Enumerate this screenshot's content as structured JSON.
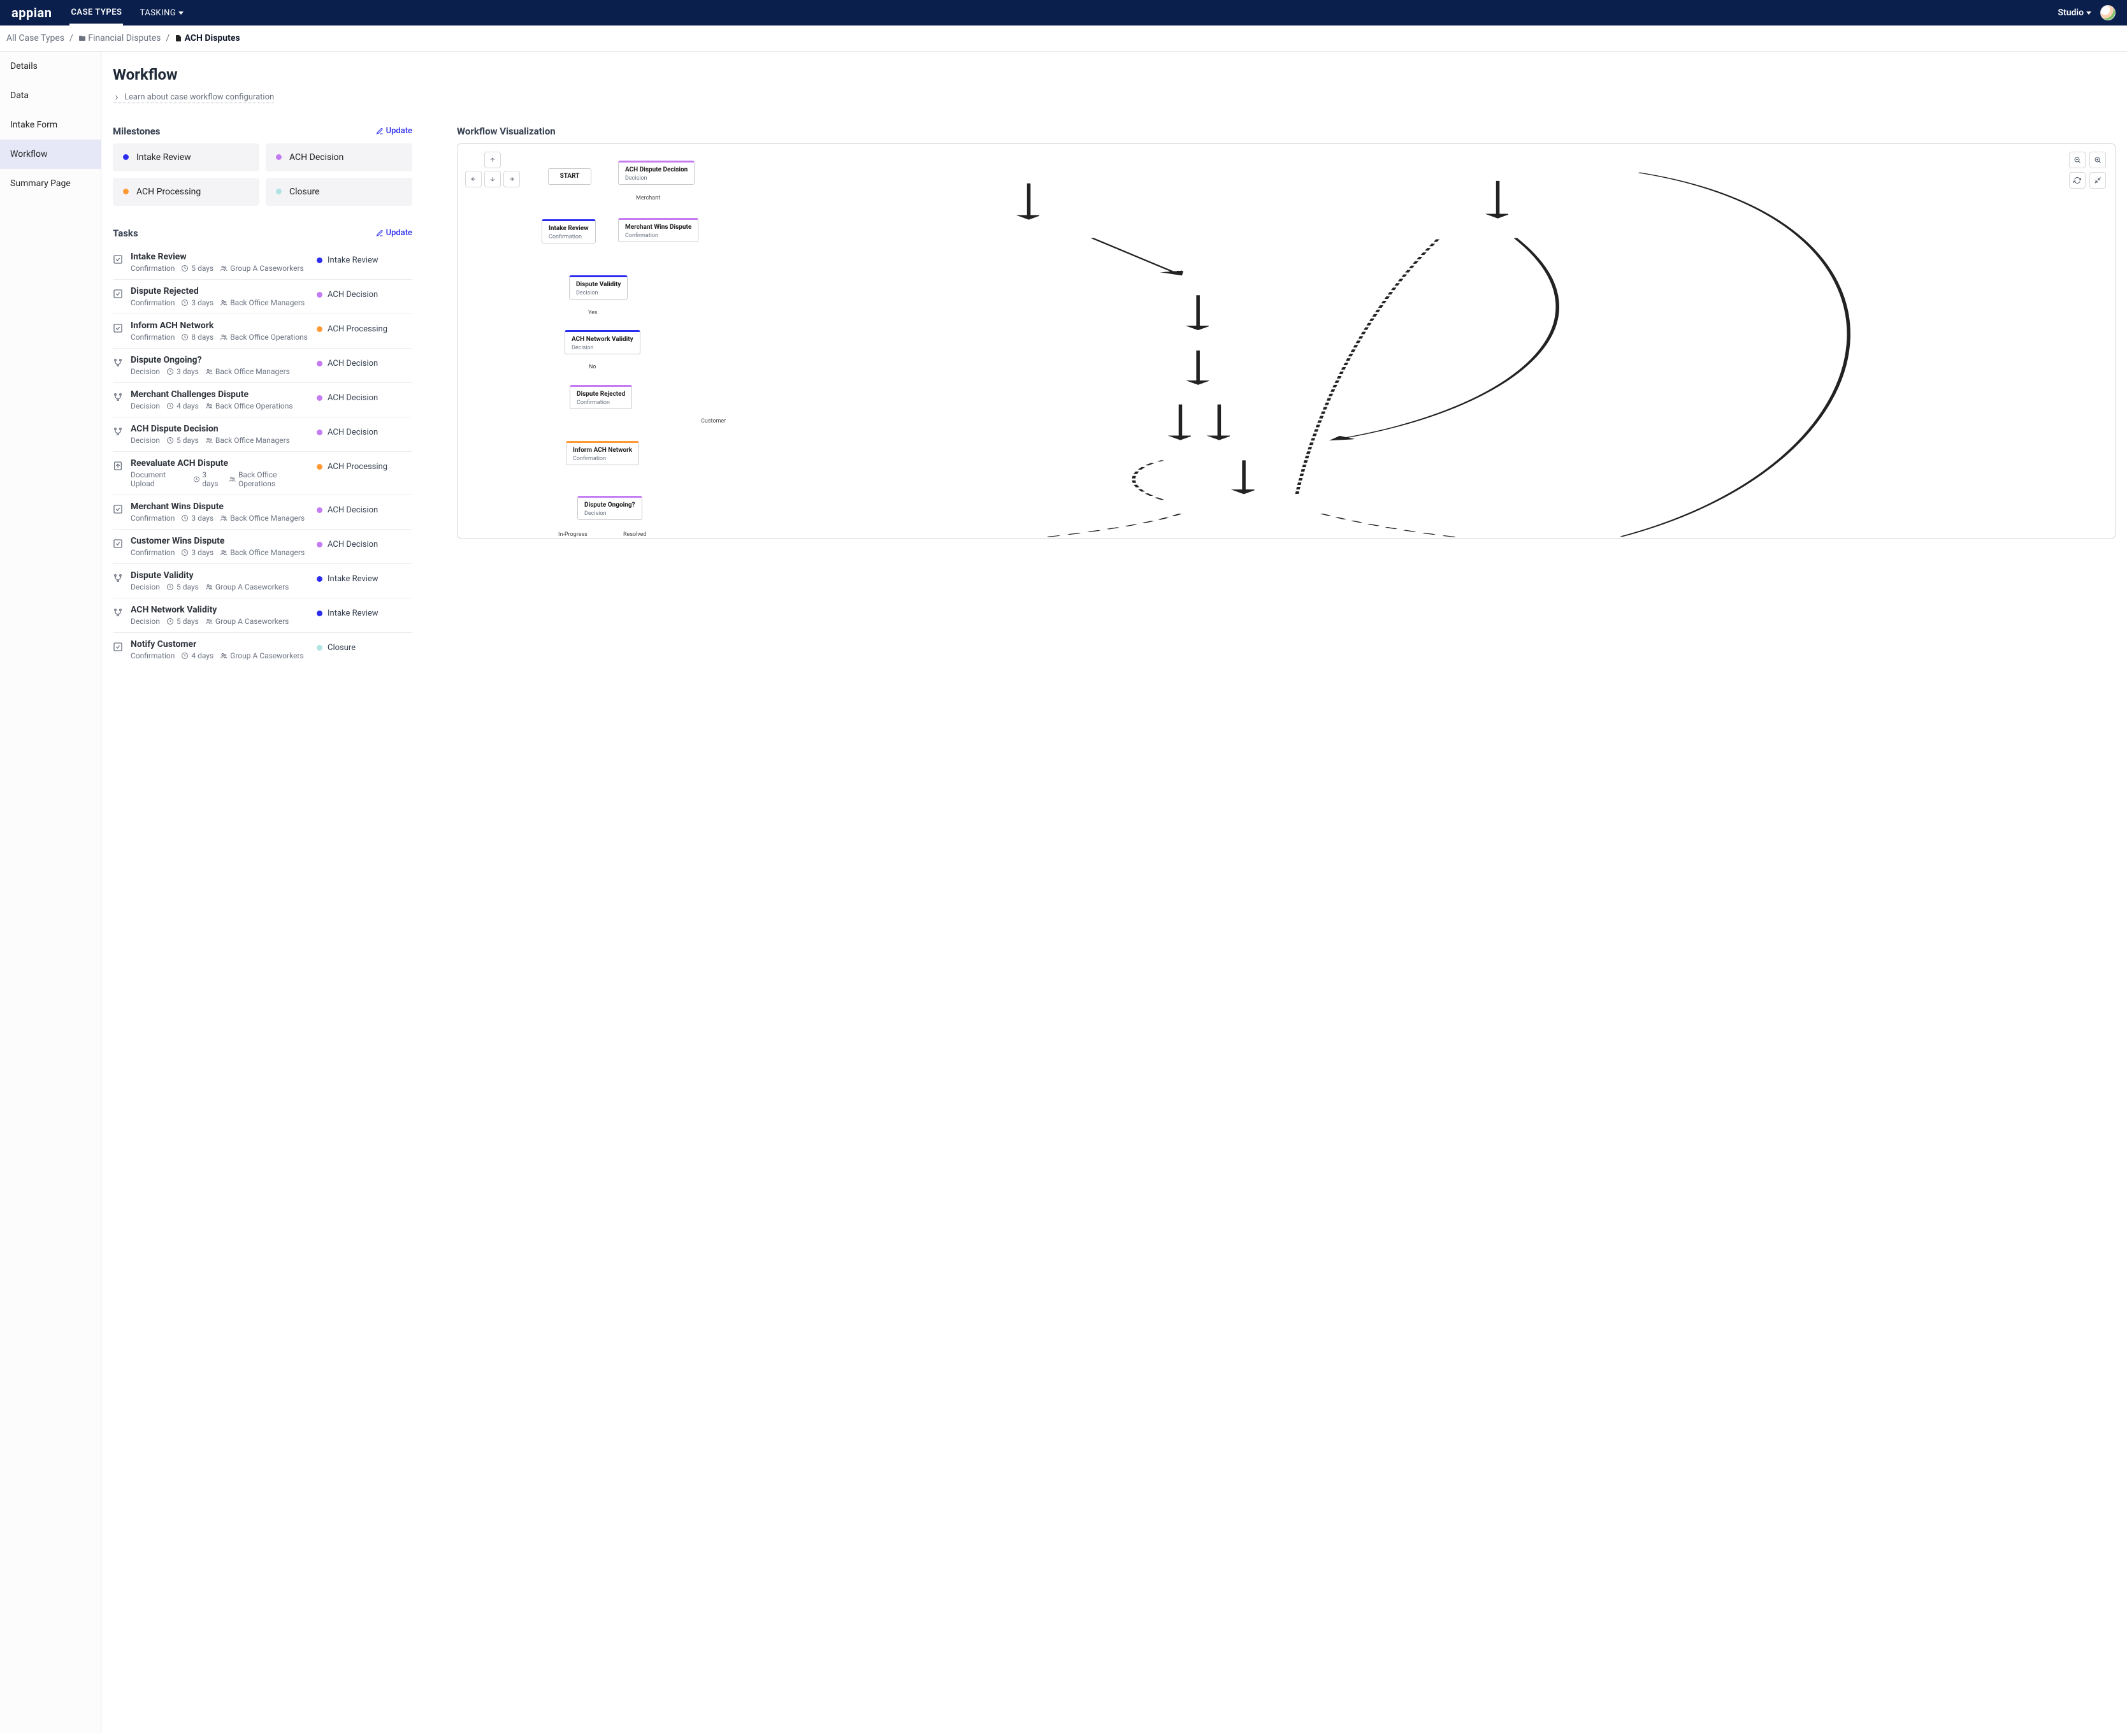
{
  "brand": "appian",
  "nav": {
    "case_types": "CASE TYPES",
    "tasking": "TASKING"
  },
  "header_right": {
    "studio": "Studio"
  },
  "breadcrumb": {
    "all": "All Case Types",
    "folder": "Financial Disputes",
    "current": "ACH Disputes"
  },
  "side_nav": [
    "Details",
    "Data",
    "Intake Form",
    "Workflow",
    "Summary Page"
  ],
  "side_nav_active": 3,
  "page": {
    "title": "Workflow",
    "learn": "Learn about case workflow configuration"
  },
  "milestones_section": {
    "title": "Milestones",
    "update": "Update",
    "items": [
      {
        "label": "Intake Review",
        "color": "blue"
      },
      {
        "label": "ACH Decision",
        "color": "purple"
      },
      {
        "label": "ACH Processing",
        "color": "orange"
      },
      {
        "label": "Closure",
        "color": "teal"
      }
    ]
  },
  "tasks_section": {
    "title": "Tasks",
    "update": "Update",
    "items": [
      {
        "icon": "check",
        "title": "Intake Review",
        "type": "Confirmation",
        "sla": "5 days",
        "group": "Group A Caseworkers",
        "ms_color": "blue",
        "ms_label": "Intake Review"
      },
      {
        "icon": "check",
        "title": "Dispute Rejected",
        "type": "Confirmation",
        "sla": "3 days",
        "group": "Back Office Managers",
        "ms_color": "purple",
        "ms_label": "ACH Decision"
      },
      {
        "icon": "check",
        "title": "Inform ACH Network",
        "type": "Confirmation",
        "sla": "8 days",
        "group": "Back Office Operations",
        "ms_color": "orange",
        "ms_label": "ACH Processing"
      },
      {
        "icon": "branch",
        "title": "Dispute Ongoing?",
        "type": "Decision",
        "sla": "3 days",
        "group": "Back Office Managers",
        "ms_color": "purple",
        "ms_label": "ACH Decision"
      },
      {
        "icon": "branch",
        "title": "Merchant Challenges Dispute",
        "type": "Decision",
        "sla": "4 days",
        "group": "Back Office Operations",
        "ms_color": "purple",
        "ms_label": "ACH Decision"
      },
      {
        "icon": "branch",
        "title": "ACH Dispute Decision",
        "type": "Decision",
        "sla": "5 days",
        "group": "Back Office Managers",
        "ms_color": "purple",
        "ms_label": "ACH Decision"
      },
      {
        "icon": "upload",
        "title": "Reevaluate ACH Dispute",
        "type": "Document Upload",
        "sla": "3 days",
        "group": "Back Office Operations",
        "ms_color": "orange",
        "ms_label": "ACH Processing"
      },
      {
        "icon": "check",
        "title": "Merchant Wins Dispute",
        "type": "Confirmation",
        "sla": "3 days",
        "group": "Back Office Managers",
        "ms_color": "purple",
        "ms_label": "ACH Decision"
      },
      {
        "icon": "check",
        "title": "Customer Wins Dispute",
        "type": "Confirmation",
        "sla": "3 days",
        "group": "Back Office Managers",
        "ms_color": "purple",
        "ms_label": "ACH Decision"
      },
      {
        "icon": "branch",
        "title": "Dispute Validity",
        "type": "Decision",
        "sla": "5 days",
        "group": "Group A Caseworkers",
        "ms_color": "blue",
        "ms_label": "Intake Review"
      },
      {
        "icon": "branch",
        "title": "ACH Network Validity",
        "type": "Decision",
        "sla": "5 days",
        "group": "Group A Caseworkers",
        "ms_color": "blue",
        "ms_label": "Intake Review"
      },
      {
        "icon": "check",
        "title": "Notify Customer",
        "type": "Confirmation",
        "sla": "4 days",
        "group": "Group A Caseworkers",
        "ms_color": "teal",
        "ms_label": "Closure"
      }
    ]
  },
  "viz": {
    "title": "Workflow Visualization",
    "nodes": {
      "start": "START",
      "intake_review": {
        "title": "Intake Review",
        "sub": "Confirmation"
      },
      "dispute_validity": {
        "title": "Dispute Validity",
        "sub": "Decision"
      },
      "ach_net_validity": {
        "title": "ACH Network Validity",
        "sub": "Decision"
      },
      "dispute_rejected": {
        "title": "Dispute Rejected",
        "sub": "Confirmation"
      },
      "inform_ach": {
        "title": "Inform ACH Network",
        "sub": "Confirmation"
      },
      "dispute_ongoing": {
        "title": "Dispute Ongoing?",
        "sub": "Decision"
      },
      "ach_decision": {
        "title": "ACH Dispute Decision",
        "sub": "Decision"
      },
      "merchant_wins": {
        "title": "Merchant Wins Dispute",
        "sub": "Confirmation"
      }
    },
    "edge_labels": {
      "merchant": "Merchant",
      "yes": "Yes",
      "no": "No",
      "customer": "Customer",
      "in_progress": "In-Progress",
      "resolved": "Resolved"
    }
  }
}
